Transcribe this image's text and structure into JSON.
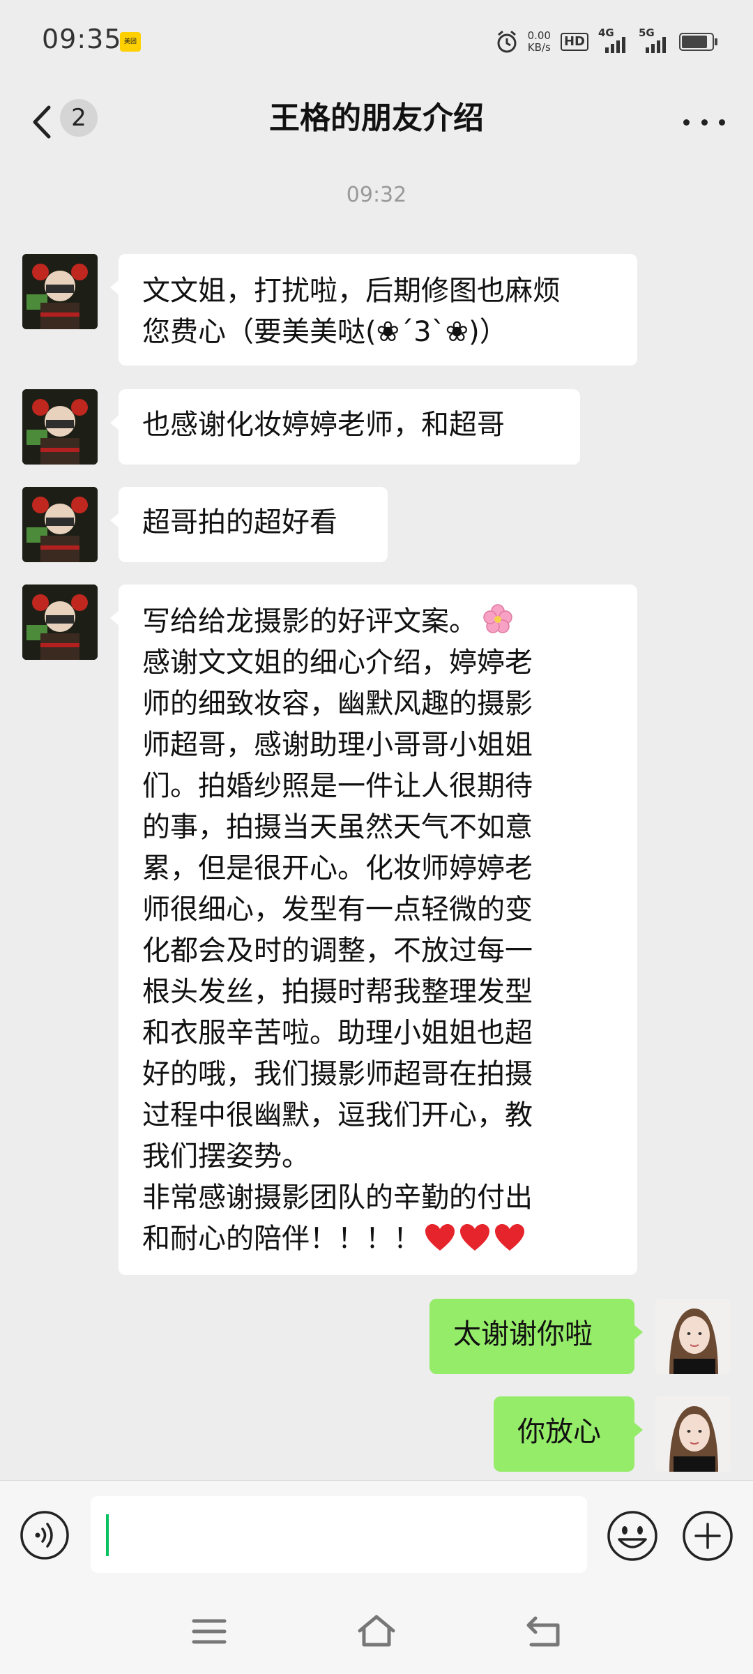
{
  "status_bar": {
    "time": "09:35",
    "app_badge": "美团",
    "net_speed_value": "0.00",
    "net_speed_unit": "KB/s",
    "hd_label": "HD",
    "signal1_label": "4G",
    "signal2_label": "5G",
    "battery_level": 0.85
  },
  "header": {
    "unread_count": "2",
    "title": "王格的朋友介绍"
  },
  "chat": {
    "time_label": "09:32",
    "messages": [
      {
        "sender": "other",
        "lines": [
          "文文姐，打扰啦，后期修图也麻烦",
          "您费心（要美美哒(❀´3`❀)）"
        ]
      },
      {
        "sender": "other",
        "lines": [
          "也感谢化妆婷婷老师，和超哥"
        ]
      },
      {
        "sender": "other",
        "lines": [
          "超哥拍的超好看"
        ]
      },
      {
        "sender": "other",
        "lines": [
          "写给给龙摄影的好评文案。",
          "感谢文文姐的细心介绍，婷婷老",
          "师的细致妆容，幽默风趣的摄影",
          "师超哥，感谢助理小哥哥小姐姐",
          "们。拍婚纱照是一件让人很期待",
          "的事，拍摄当天虽然天气不如意",
          "累，但是很开心。化妆师婷婷老",
          "师很细心，发型有一点轻微的变",
          "化都会及时的调整，不放过每一",
          "根头发丝，拍摄时帮我整理发型",
          "和衣服辛苦啦。助理小姐姐也超",
          "好的哦，我们摄影师超哥在拍摄",
          "过程中很幽默，逗我们开心，教",
          "我们摆姿势。",
          "非常感谢摄影团队的辛勤的付出",
          "和耐心的陪伴！！！！"
        ],
        "emoji": [
          "cherry-blossom",
          "red-heart"
        ]
      },
      {
        "sender": "self",
        "lines": [
          "太谢谢你啦"
        ]
      },
      {
        "sender": "self",
        "lines": [
          "你放心"
        ]
      }
    ]
  },
  "colors": {
    "background": "#ededed",
    "bubble_other": "#ffffff",
    "bubble_self": "#95ec69",
    "cursor": "#07c160"
  },
  "icons": [
    "back-icon",
    "more-icon",
    "voice-icon",
    "emoji-icon",
    "plus-icon",
    "menu-icon",
    "home-icon",
    "back-nav-icon"
  ]
}
